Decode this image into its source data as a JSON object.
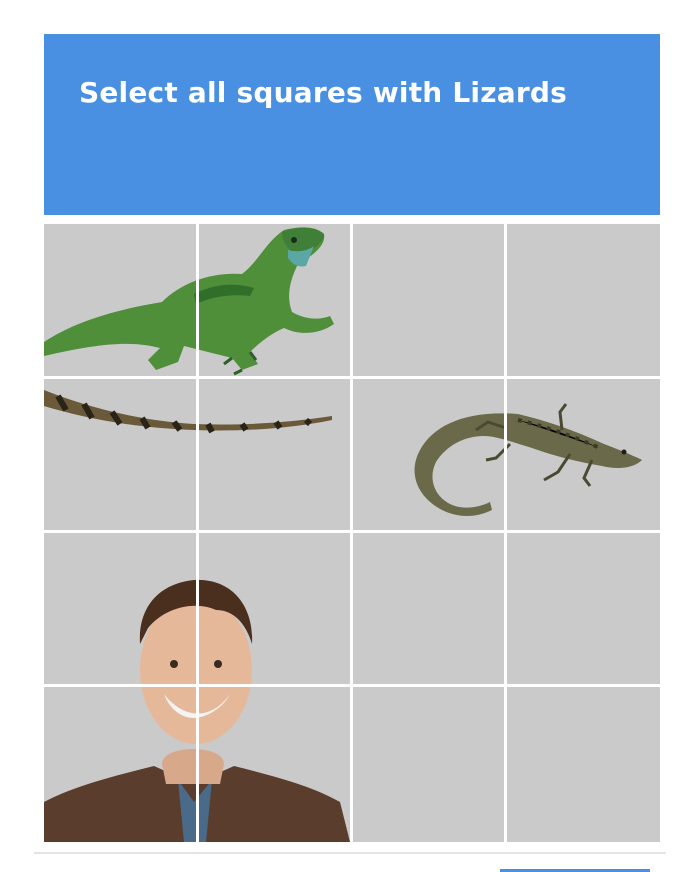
{
  "captcha": {
    "prompt": "Select all squares with Lizards",
    "header_color": "#4a90e2",
    "grid": {
      "rows": 4,
      "cols": 4
    },
    "verify_color": "#4a90e2"
  }
}
